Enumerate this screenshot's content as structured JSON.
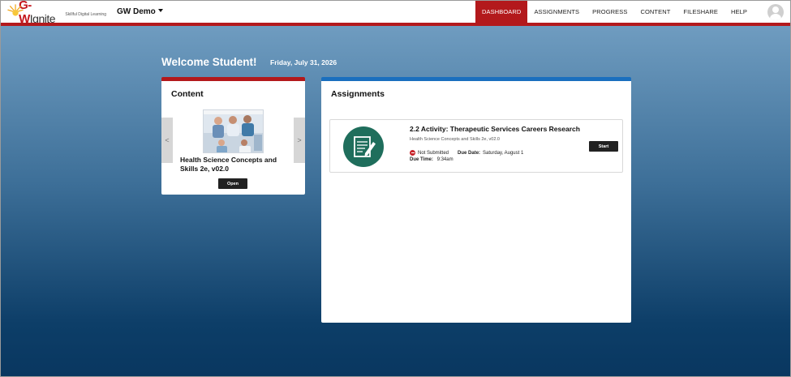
{
  "header": {
    "logo": {
      "brand_prefix": "G-W",
      "brand_suffix": "Ignite",
      "tagline": "Skillful Digital Learning"
    },
    "org_menu_label": "GW Demo",
    "nav": [
      {
        "label": "DASHBOARD",
        "active": true
      },
      {
        "label": "ASSIGNMENTS",
        "active": false
      },
      {
        "label": "PROGRESS",
        "active": false
      },
      {
        "label": "CONTENT",
        "active": false
      },
      {
        "label": "FILESHARE",
        "active": false
      },
      {
        "label": "HELP",
        "active": false
      }
    ]
  },
  "dashboard": {
    "welcome": "Welcome Student!",
    "date": "Friday, July 31, 2026"
  },
  "content_card": {
    "title": "Content",
    "prev_label": "<",
    "next_label": ">",
    "book_title": "Health Science Concepts and Skills 2e, v02.0",
    "open_label": "Open"
  },
  "assignments_card": {
    "title": "Assignments",
    "items": [
      {
        "title": "2.2 Activity: Therapeutic Services Careers Research",
        "subtitle": "Health Science Concepts and Skills 2e, v02.0",
        "status": "Not Submitted",
        "due_date_label": "Due Date:",
        "due_date": "Saturday, August 1",
        "due_time_label": "Due Time:",
        "due_time": "9:34am",
        "action_label": "Start"
      }
    ]
  },
  "colors": {
    "brand_red": "#b3191c",
    "assign_blue": "#1a6fbe",
    "assignment_icon": "#1f6e5c"
  }
}
